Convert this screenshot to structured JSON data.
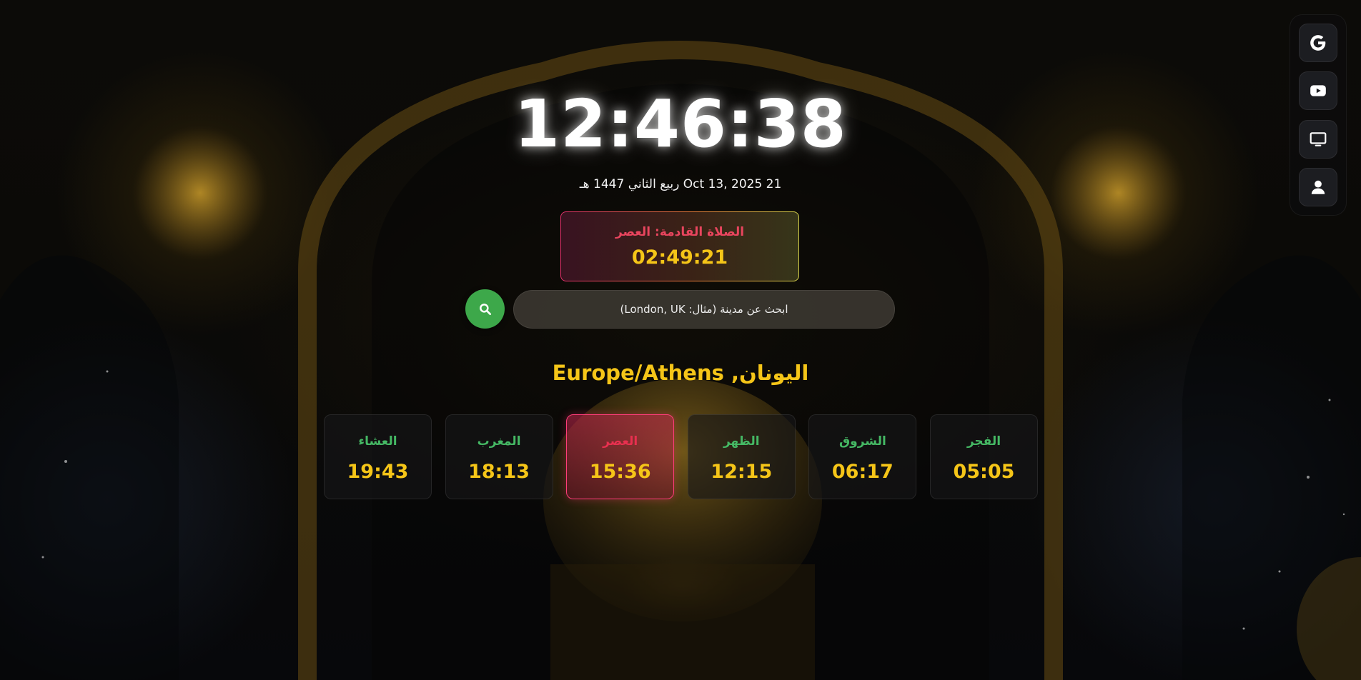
{
  "clock": {
    "time": "12:46:38"
  },
  "date": {
    "text": "21 Oct 13, 2025 ربيع الثاني 1447 هـ"
  },
  "next_prayer": {
    "label": "الصلاة القادمة: العصر",
    "countdown": "02:49:21"
  },
  "search": {
    "placeholder": "ابحث عن مدينة (مثال: London, UK)"
  },
  "location": {
    "text": "اليونان, Europe/Athens"
  },
  "prayers": [
    {
      "name": "الفجر",
      "time": "05:05",
      "active": false
    },
    {
      "name": "الشروق",
      "time": "06:17",
      "active": false
    },
    {
      "name": "الظهر",
      "time": "12:15",
      "active": false
    },
    {
      "name": "العصر",
      "time": "15:36",
      "active": true
    },
    {
      "name": "المغرب",
      "time": "18:13",
      "active": false
    },
    {
      "name": "العشاء",
      "time": "19:43",
      "active": false
    }
  ],
  "toolbar": {
    "items": [
      {
        "icon": "google-icon"
      },
      {
        "icon": "youtube-icon"
      },
      {
        "icon": "monitor-icon"
      },
      {
        "icon": "user-icon"
      }
    ]
  },
  "colors": {
    "accent_gold": "#f5c518",
    "prayer_name_green": "#45b864",
    "active_pink": "#ff3d7a",
    "next_label_red": "#e8455e",
    "search_button_green": "#3da84a"
  }
}
